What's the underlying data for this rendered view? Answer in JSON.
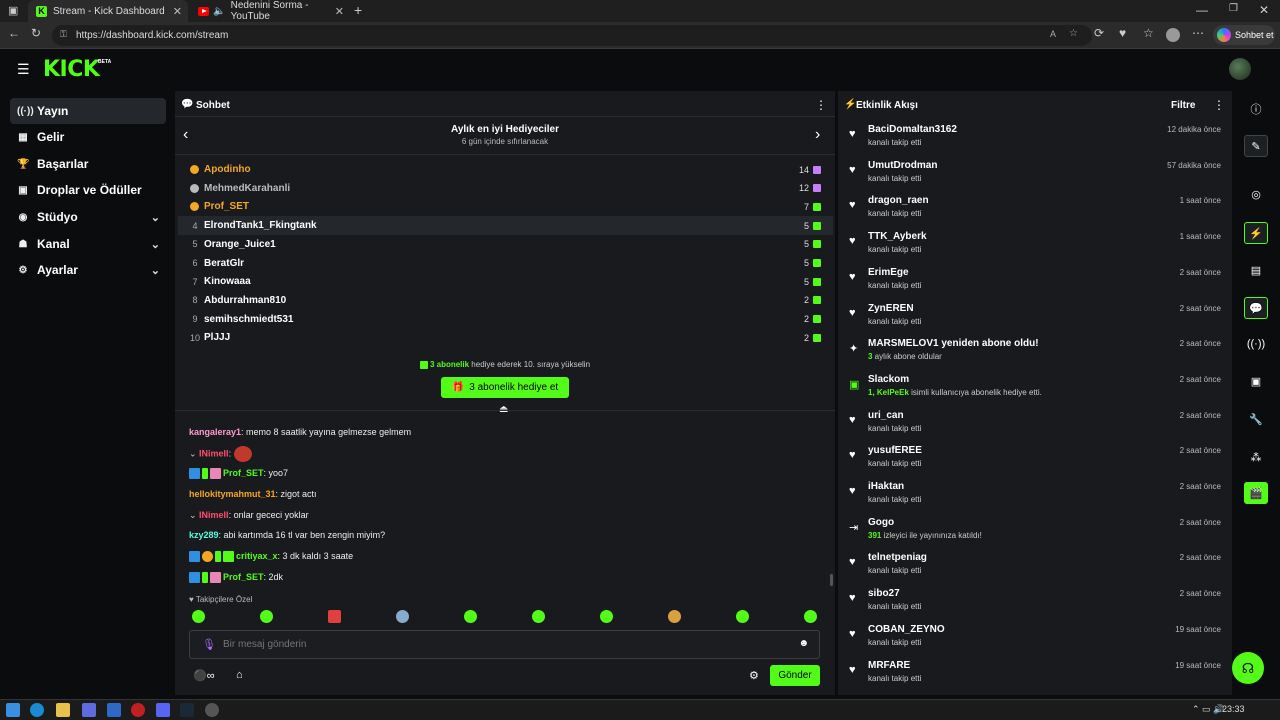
{
  "browser": {
    "tabs": [
      {
        "title": "Stream - Kick Dashboard"
      },
      {
        "title": "Nedenini Sorma - YouTube"
      }
    ],
    "url": "https://dashboard.kick.com/stream",
    "copilot_label": "Sohbet et",
    "new_tab": "+"
  },
  "brand": {
    "logo": "KICK",
    "beta": "BETA",
    "accent": "#53fc18"
  },
  "sidebar": {
    "items": [
      {
        "label": "Yayın",
        "icon": "broadcast-icon"
      },
      {
        "label": "Gelir",
        "icon": "revenue-icon"
      },
      {
        "label": "Başarılar",
        "icon": "trophy-icon"
      },
      {
        "label": "Droplar ve Ödüller",
        "icon": "gift-icon"
      },
      {
        "label": "Stüdyo",
        "icon": "studio-icon"
      },
      {
        "label": "Kanal",
        "icon": "channel-icon"
      },
      {
        "label": "Ayarlar",
        "icon": "settings-icon"
      }
    ]
  },
  "chat": {
    "title": "Sohbet",
    "gifters": {
      "title": "Aylık en iyi Hediyeciler",
      "subtitle": "6 gün içinde sıfırlanacak",
      "rows": [
        {
          "rank": "",
          "name": "Apodinho",
          "count": "14",
          "color": "#f5a623"
        },
        {
          "rank": "",
          "name": "MehmedKarahanli",
          "count": "12",
          "color": "#bbbbbb"
        },
        {
          "rank": "",
          "name": "Prof_SET",
          "count": "7",
          "color": "#f5a623"
        },
        {
          "rank": "4",
          "name": "ElrondTank1_Fkingtank",
          "count": "5",
          "color": "#ffffff"
        },
        {
          "rank": "5",
          "name": "Orange_Juice1",
          "count": "5",
          "color": "#ffffff"
        },
        {
          "rank": "6",
          "name": "BeratGlr",
          "count": "5",
          "color": "#ffffff"
        },
        {
          "rank": "7",
          "name": "Kinowaaa",
          "count": "5",
          "color": "#ffffff"
        },
        {
          "rank": "8",
          "name": "Abdurrahman810",
          "count": "2",
          "color": "#ffffff"
        },
        {
          "rank": "9",
          "name": "semihschmiedt531",
          "count": "2",
          "color": "#ffffff"
        },
        {
          "rank": "10",
          "name": "PlJJJ",
          "count": "2",
          "color": "#ffffff"
        }
      ],
      "cta_count": "3 abonelik",
      "cta_text": " hediye ederek 10. sıraya yükselin",
      "gift_button": "3 abonelik hediye et"
    },
    "messages": [
      {
        "user": "kangaleray1",
        "text": ": memo 8 saatlik yayına gelmezse gelmem",
        "color": "#ff9bd0"
      },
      {
        "user": "INimeII",
        "text": ":",
        "color": "#ff4d6d"
      },
      {
        "user": "Prof_SET",
        "text": ": yoo7",
        "color": "#53fc18"
      },
      {
        "user": "hellokitymahmut_31",
        "text": ": zigot actı",
        "color": "#f5a623"
      },
      {
        "user": "INimeII",
        "text": ": onlar gececi yoklar",
        "color": "#ff4d6d"
      },
      {
        "user": "kzy289",
        "text": ": abi kartımda 16 tl var ben zengin miyim?",
        "color": "#53fce0"
      },
      {
        "user": "critiyax_x",
        "text": ": 3 dk kaldı 3 saate",
        "color": "#53fc18"
      },
      {
        "user": "Prof_SET",
        "text": ": 2dk",
        "color": "#53fc18"
      }
    ],
    "followers_only": "Takipçilere Özel",
    "input_placeholder": "Bir mesaj gönderin",
    "send_label": "Gönder"
  },
  "activity": {
    "title": "Etkinlik Akışı",
    "filter_label": "Filtre",
    "events": [
      {
        "name": "BaciDomaltan3162",
        "sub": "kanalı takip etti",
        "time": "12 dakika önce",
        "icon": "heart-icon"
      },
      {
        "name": "UmutDrodman",
        "sub": "kanalı takip etti",
        "time": "57 dakika önce",
        "icon": "heart-icon"
      },
      {
        "name": "dragon_raen",
        "sub": "kanalı takip etti",
        "time": "1 saat önce",
        "icon": "heart-icon"
      },
      {
        "name": "TTK_Ayberk",
        "sub": "kanalı takip etti",
        "time": "1 saat önce",
        "icon": "heart-icon"
      },
      {
        "name": "ErimEge",
        "sub": "kanalı takip etti",
        "time": "2 saat önce",
        "icon": "heart-icon"
      },
      {
        "name": "ZynEREN",
        "sub": "kanalı takip etti",
        "time": "2 saat önce",
        "icon": "heart-icon"
      },
      {
        "name": "MARSMELOV1 yeniden abone oldu!",
        "highlight": "3",
        "sub": " aylık abone oldular",
        "time": "2 saat önce",
        "icon": "sparkle-icon"
      },
      {
        "name": "Slackom",
        "highlight": "1, KelPeEk",
        "sub": " isimli kullanıcıya abonelik hediye etti.",
        "time": "2 saat önce",
        "icon": "gift-icon"
      },
      {
        "name": "uri_can",
        "sub": "kanalı takip etti",
        "time": "2 saat önce",
        "icon": "heart-icon"
      },
      {
        "name": "yusufEREE",
        "sub": "kanalı takip etti",
        "time": "2 saat önce",
        "icon": "heart-icon"
      },
      {
        "name": "iHaktan",
        "sub": "kanalı takip etti",
        "time": "2 saat önce",
        "icon": "heart-icon"
      },
      {
        "name": "Gogo",
        "highlight": "391",
        "sub": " izleyici ile yayınınıza katıldı!",
        "time": "2 saat önce",
        "icon": "raid-icon"
      },
      {
        "name": "telnetpeniag",
        "sub": "kanalı takip etti",
        "time": "2 saat önce",
        "icon": "heart-icon"
      },
      {
        "name": "sibo27",
        "sub": "kanalı takip etti",
        "time": "2 saat önce",
        "icon": "heart-icon"
      },
      {
        "name": "COBAN_ZEYNO",
        "sub": "kanalı takip etti",
        "time": "19 saat önce",
        "icon": "heart-icon"
      },
      {
        "name": "MRFARE",
        "sub": "kanalı takip etti",
        "time": "19 saat önce",
        "icon": "heart-icon"
      }
    ]
  },
  "taskbar": {
    "time": "23:33"
  }
}
